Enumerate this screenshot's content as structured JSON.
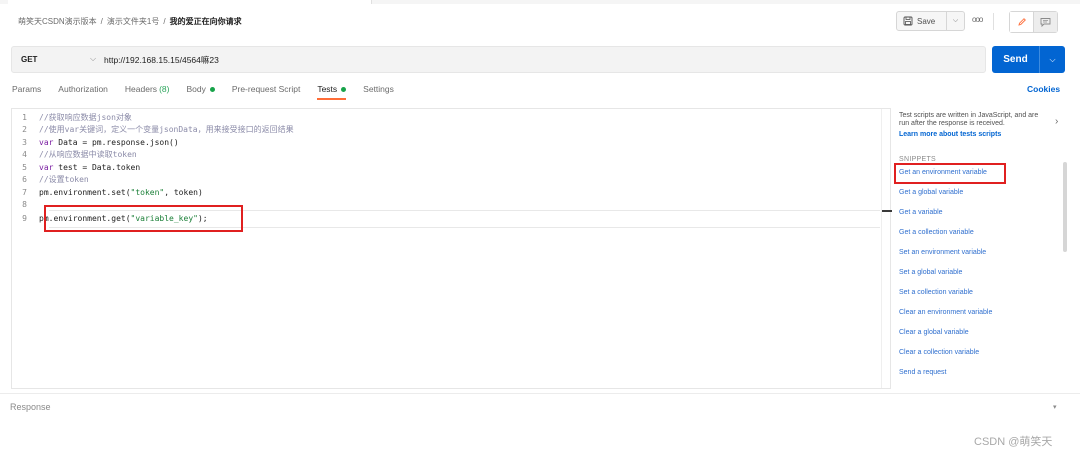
{
  "breadcrumb": {
    "items": [
      "萌笑天CSDN演示版本",
      "演示文件夹1号"
    ],
    "separator": "/",
    "current": "我的爱正在向你请求"
  },
  "toolbar": {
    "save_label": "Save",
    "save_caret": "⌵",
    "more": "ooo"
  },
  "request": {
    "method": "GET",
    "method_caret": "⌵",
    "url": "http://192.168.15.15/4564嘛23",
    "send_label": "Send",
    "send_caret": "⌵"
  },
  "tabs": {
    "params": "Params",
    "authorization": "Authorization",
    "headers": "Headers",
    "headers_count": "(8)",
    "body": "Body",
    "prerequest": "Pre-request Script",
    "tests": "Tests",
    "settings": "Settings",
    "cookies": "Cookies"
  },
  "editor": {
    "lines": [
      {
        "n": "1",
        "text": "//获取响应数据json对象"
      },
      {
        "n": "2",
        "text": "//使用var关键词，定义一个变量jsonData，用来接受接口的返回结果"
      },
      {
        "n": "3",
        "kw": "var",
        "text": " Data = pm.response.json()"
      },
      {
        "n": "4",
        "text": "//从响应数据中读取token"
      },
      {
        "n": "5",
        "kw": "var",
        "text": " test = Data.token"
      },
      {
        "n": "6",
        "text": "//设置token"
      },
      {
        "n": "7",
        "pre": "pm.environment.set(",
        "str": "\"token\"",
        "post": ", token)"
      },
      {
        "n": "8",
        "text": ""
      },
      {
        "n": "9",
        "pre": "pm.environment.get(",
        "str": "\"variable_key\"",
        "post": ");"
      }
    ]
  },
  "snippets_panel": {
    "description": "Test scripts are written in JavaScript, and are run after the response is received.",
    "learn_more": "Learn more about tests scripts",
    "arrow": "›",
    "section_title": "SNIPPETS",
    "items": [
      "Get an environment variable",
      "Get a global variable",
      "Get a variable",
      "Get a collection variable",
      "Set an environment variable",
      "Set a global variable",
      "Set a collection variable",
      "Clear an environment variable",
      "Clear a global variable",
      "Clear a collection variable",
      "Send a request"
    ]
  },
  "response": {
    "label": "Response",
    "caret": "▾"
  },
  "watermark": "CSDN @萌笑天",
  "colors": {
    "accent": "#ff6c37",
    "send": "#0265d2",
    "status_dot": "#17a34a",
    "annotation": "#e02020"
  }
}
